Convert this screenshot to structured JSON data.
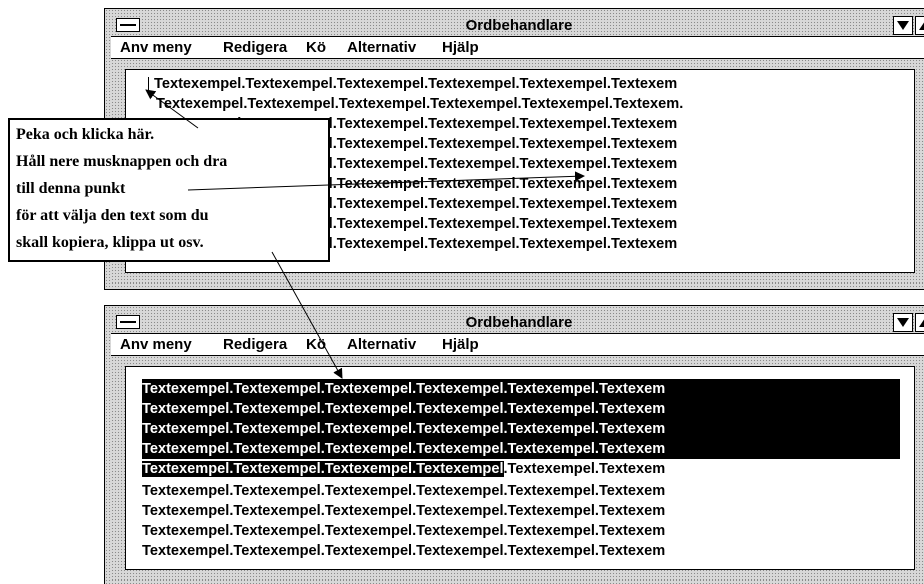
{
  "window_title": "Ordbehandlare",
  "menu": {
    "anv_meny": "Anv meny",
    "redigera": "Redigera",
    "ko": "Kö",
    "alternativ": "Alternativ",
    "hjalp": "Hjälp"
  },
  "document_lines": [
    "Textexempel.Textexempel.Textexempel.Textexempel.Textexempel.Textexem",
    "Textexempel.Textexempel.Textexempel.Textexempel.Textexempel.Textexem.",
    "Textexempel.Textexempel.Textexempel.Textexempel.Textexempel.Textexem",
    "Textexempel.Textexempel.Textexempel.Textexempel.Textexempel.Textexem",
    "Textexempel.Textexempel.Textexempel.Textexempel.Textexempel.Textexem",
    "Textexempel.Textexempel.Textexempel.Textexempel.Textexempel.Textexem",
    "Textexempel.Textexempel.Textexempel.Textexempel.Textexempel.Textexem",
    "Textexempel.Textexempel.Textexempel.Textexempel.Textexempel.Textexem",
    "Textexempel.Textexempel.Textexempel.Textexempel.Textexempel.Textexem"
  ],
  "selection": {
    "full_lines": 4,
    "last_line_selected": "Textexempel.Textexempel.Textexempel.Textexempel",
    "last_line_rest": ".Textexempel.Textexem"
  },
  "callout": {
    "line1": "Peka och klicka här.",
    "line2": "Håll nere musknappen och dra",
    "line3": "till denna punkt",
    "line4": "för att välja den text som du",
    "line5": "skall kopiera, klippa ut osv."
  }
}
